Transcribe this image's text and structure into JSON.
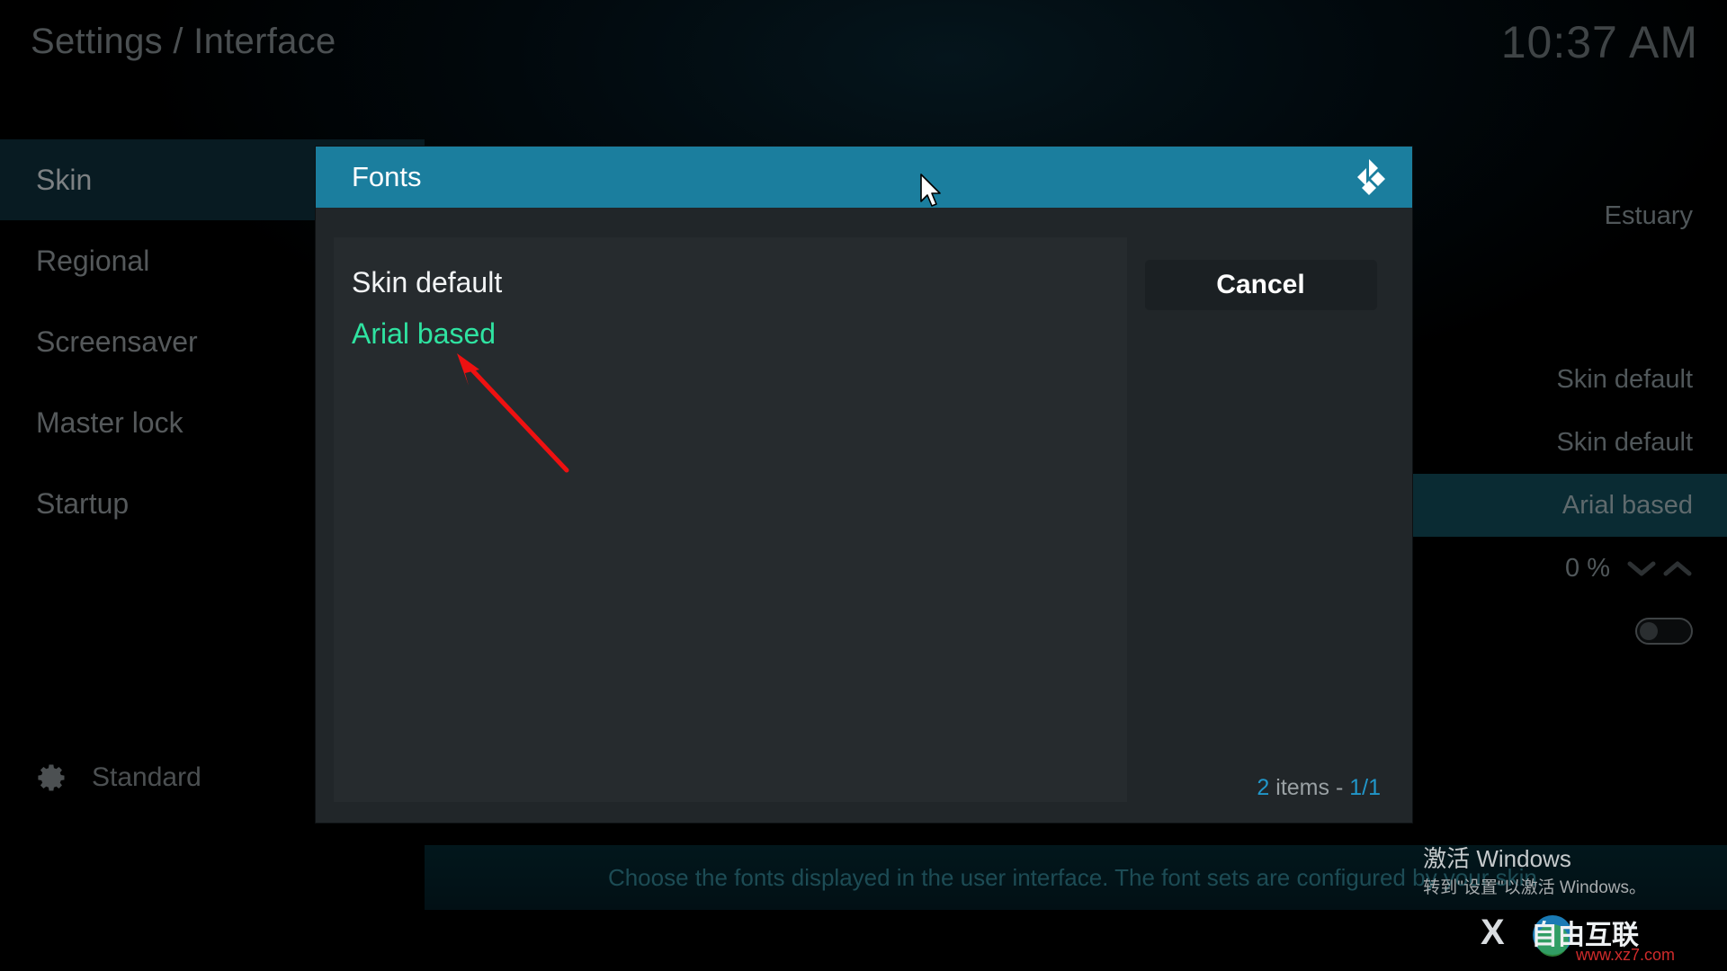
{
  "header": {
    "title": "Settings / Interface",
    "clock": "10:37 AM"
  },
  "sidebar": {
    "items": [
      {
        "label": "Skin",
        "selected": true
      },
      {
        "label": "Regional",
        "selected": false
      },
      {
        "label": "Screensaver",
        "selected": false
      },
      {
        "label": "Master lock",
        "selected": false
      },
      {
        "label": "Startup",
        "selected": false
      }
    ],
    "level": {
      "icon": "gear-icon",
      "label": "Standard"
    }
  },
  "settings_values": {
    "skin_name": "Estuary",
    "value_a": "Skin default",
    "value_b": "Skin default",
    "value_c": "Arial based",
    "value_d": "0 %",
    "spinner_down_icon": "chevron-down-icon",
    "spinner_up_icon": "chevron-up-icon",
    "toggle_state": "off"
  },
  "dialog": {
    "title": "Fonts",
    "logo_icon": "kodi-logo-icon",
    "list": [
      {
        "label": "Skin default",
        "state": "normal"
      },
      {
        "label": "Arial based",
        "state": "selected"
      }
    ],
    "cancel_label": "Cancel",
    "items_count": {
      "count": "2",
      "middle": " items - ",
      "page": "1/1"
    }
  },
  "description": "Choose the fonts displayed in the user interface. The font sets are configured by your skin.",
  "watermarks": {
    "windows_title": "激活 Windows",
    "windows_sub": "转到\"设置\"以激活 Windows。",
    "site_name": "自由互联",
    "site_url": "www.xz7.com",
    "site_letter": "X"
  },
  "annotations": {
    "arrow_color": "#ee1111",
    "cursor_icon": "mouse-pointer-icon"
  },
  "colors": {
    "accent_blue": "#1b7e9e",
    "selected_green": "#2fe3a1",
    "count_blue": "#2196c9"
  }
}
